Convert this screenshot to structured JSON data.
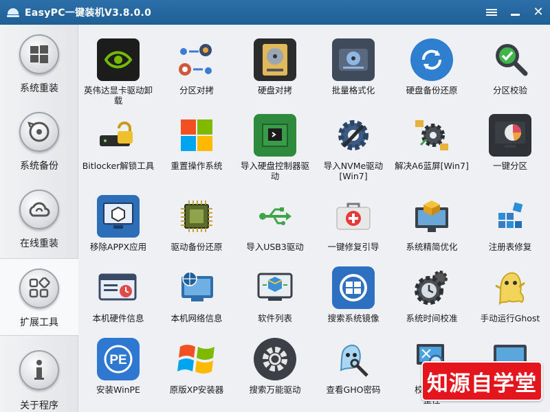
{
  "window": {
    "title": "EasyPC一键装机V3.8.0.0"
  },
  "sidebar": {
    "items": [
      {
        "label": "系统重装",
        "icon": "windows-logo-icon"
      },
      {
        "label": "系统备份",
        "icon": "backup-disc-icon"
      },
      {
        "label": "在线重装",
        "icon": "cloud-icon"
      },
      {
        "label": "扩展工具",
        "icon": "tools-grid-icon",
        "active": true
      },
      {
        "label": "关于程序",
        "icon": "info-icon"
      }
    ]
  },
  "tools": [
    {
      "label": "英伟达显卡驱动卸载",
      "icon": "nvidia-icon"
    },
    {
      "label": "分区对拷",
      "icon": "partition-copy-icon"
    },
    {
      "label": "硬盘对拷",
      "icon": "disk-copy-icon"
    },
    {
      "label": "批量格式化",
      "icon": "format-disk-icon"
    },
    {
      "label": "硬盘备份还原",
      "icon": "disk-restore-icon"
    },
    {
      "label": "分区校验",
      "icon": "partition-check-icon"
    },
    {
      "label": "Bitlocker解锁工具",
      "icon": "bitlocker-lock-icon"
    },
    {
      "label": "重置操作系统",
      "icon": "windows-reset-icon"
    },
    {
      "label": "导入硬盘控制器驱动",
      "icon": "disk-controller-icon"
    },
    {
      "label": "导入NVMe驱动[Win7]",
      "icon": "nvme-gear-icon"
    },
    {
      "label": "解决A6蓝屏[Win7]",
      "icon": "bluescreen-fix-icon"
    },
    {
      "label": "一键分区",
      "icon": "pie-partition-icon"
    },
    {
      "label": "移除APPX应用",
      "icon": "appx-remove-icon"
    },
    {
      "label": "驱动备份还原",
      "icon": "chip-icon"
    },
    {
      "label": "导入USB3驱动",
      "icon": "usb-icon"
    },
    {
      "label": "一键修复引导",
      "icon": "first-aid-icon"
    },
    {
      "label": "系统精简优化",
      "icon": "system-optimize-icon"
    },
    {
      "label": "注册表修复",
      "icon": "registry-icon"
    },
    {
      "label": "本机硬件信息",
      "icon": "hardware-info-icon"
    },
    {
      "label": "本机网络信息",
      "icon": "network-globe-icon"
    },
    {
      "label": "软件列表",
      "icon": "software-list-icon"
    },
    {
      "label": "搜索系统镜像",
      "icon": "search-image-icon"
    },
    {
      "label": "系统时间校准",
      "icon": "clock-gear-icon"
    },
    {
      "label": "手动运行Ghost",
      "icon": "ghost-icon"
    },
    {
      "label": "安装WinPE",
      "icon": "winpe-icon"
    },
    {
      "label": "原版XP安装器",
      "icon": "windows-xp-icon"
    },
    {
      "label": "搜索万能驱动",
      "icon": "gear-icon"
    },
    {
      "label": "查看GHO密码",
      "icon": "ghost-key-icon"
    },
    {
      "label": "校验镜像",
      "label_line2": "整性",
      "icon": "image-verify-icon"
    },
    {
      "label": "",
      "icon": "monitor-icon"
    }
  ],
  "watermark": {
    "text": "知源自学堂"
  },
  "colors": {
    "titlebar": "#2c6fa9",
    "watermark": "#e4151d"
  }
}
